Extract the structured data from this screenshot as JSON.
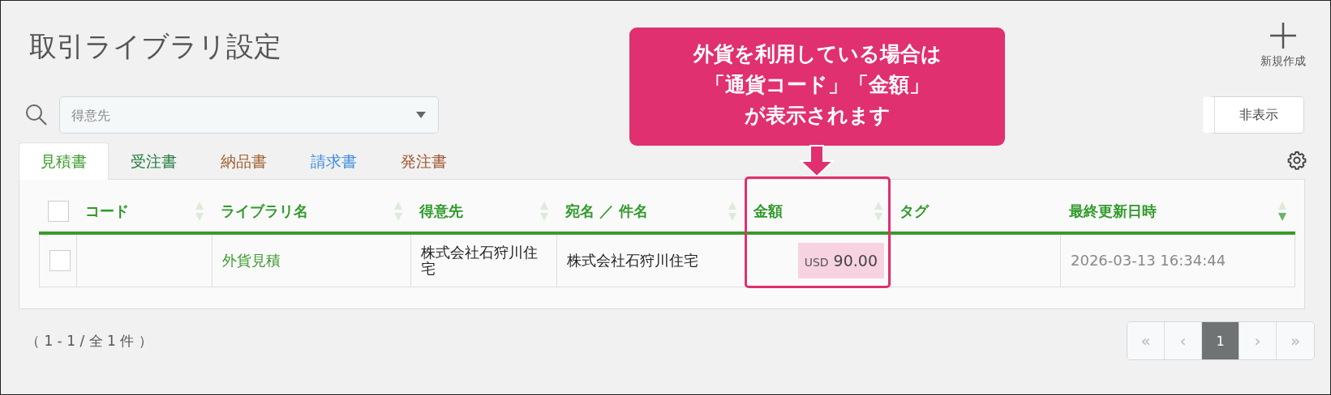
{
  "page": {
    "title": "取引ライブラリ設定"
  },
  "new_button": {
    "label": "新規作成"
  },
  "search": {
    "placeholder": "得意先"
  },
  "hide_button": {
    "label": "非表示"
  },
  "tabs": [
    {
      "label": "見積書",
      "selected": true,
      "color": "#3a9a2a"
    },
    {
      "label": "受注書",
      "selected": false,
      "color": "#1e7a3c"
    },
    {
      "label": "納品書",
      "selected": false,
      "color": "#a0602e"
    },
    {
      "label": "請求書",
      "selected": false,
      "color": "#3f8ce0"
    },
    {
      "label": "発注書",
      "selected": false,
      "color": "#a0522d"
    }
  ],
  "table": {
    "select_all": {
      "checked": false
    },
    "columns": [
      {
        "label": "コード",
        "sortable": true,
        "sorted": false
      },
      {
        "label": "ライブラリ名",
        "sortable": true,
        "sorted": false
      },
      {
        "label": "得意先",
        "sortable": true,
        "sorted": false
      },
      {
        "label": "宛名 ／ 件名",
        "sortable": true,
        "sorted": false
      },
      {
        "label": "金額",
        "sortable": true,
        "sorted": false
      },
      {
        "label": "タグ",
        "sortable": false,
        "sorted": false
      },
      {
        "label": "最終更新日時",
        "sortable": true,
        "sorted": true
      }
    ],
    "rows": [
      {
        "checked": false,
        "library_name": "外貨見積",
        "customer": "株式会社石狩川住宅",
        "addressee": "株式会社石狩川住宅",
        "amount": {
          "currency": "USD",
          "value": "90.00"
        },
        "updated": "2026-03-13 16:34:44"
      }
    ]
  },
  "record_count": "（ 1 - 1 / 全 1 件 ）",
  "pagination": [
    {
      "label": "«",
      "selected": false,
      "disabled": true
    },
    {
      "label": "‹",
      "selected": false,
      "disabled": true
    },
    {
      "label": "1",
      "selected": true,
      "disabled": false
    },
    {
      "label": "›",
      "selected": false,
      "disabled": true
    },
    {
      "label": "»",
      "selected": false,
      "disabled": true
    }
  ],
  "callout": {
    "lines": [
      "外貨を利用している場合は",
      "「通貨コード」「金額」",
      "が表示されます"
    ]
  }
}
